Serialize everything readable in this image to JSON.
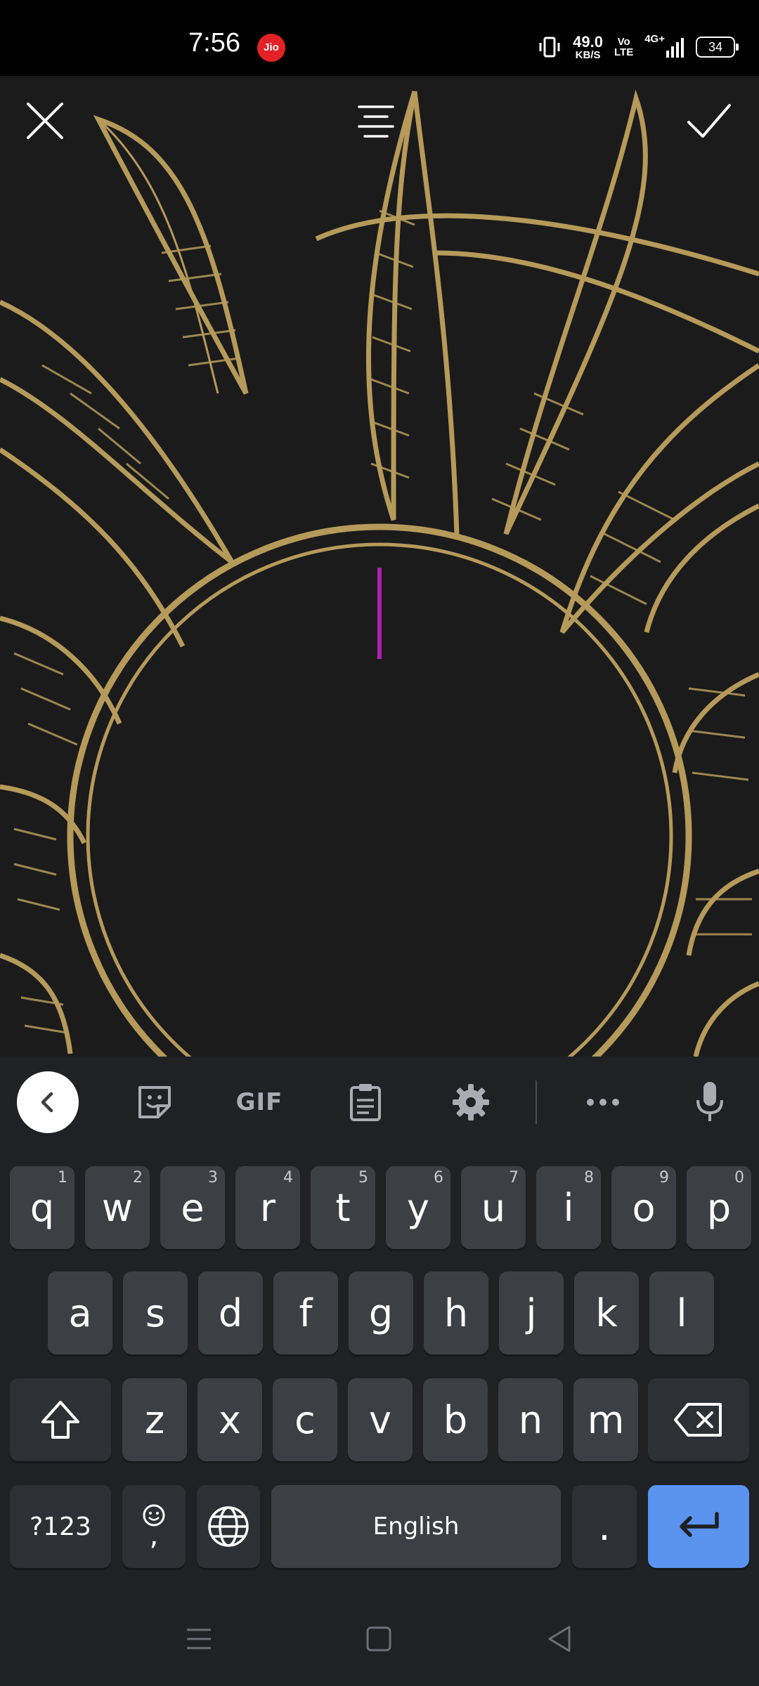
{
  "status_bar": {
    "time": "7:56",
    "carrier_badge": "Jio",
    "speed_value": "49.0",
    "speed_unit": "KB/S",
    "volte_top": "Vo",
    "volte_bottom": "LTE",
    "network": "4G+",
    "battery": "34"
  },
  "editor": {
    "close_icon": "close-icon",
    "align_icon": "text-align-center-icon",
    "confirm_icon": "check-icon",
    "cursor_color": "#b01fb5",
    "artwork": "black and gold sun illustration"
  },
  "keyboard": {
    "toolbar": {
      "back_icon": "chevron-left-icon",
      "sticker_icon": "sticker-icon",
      "gif_label": "GIF",
      "clipboard_icon": "clipboard-icon",
      "settings_icon": "gear-icon",
      "more_icon": "more-horizontal-icon",
      "mic_icon": "microphone-icon"
    },
    "row1": [
      {
        "key": "q",
        "hint": "1"
      },
      {
        "key": "w",
        "hint": "2"
      },
      {
        "key": "e",
        "hint": "3"
      },
      {
        "key": "r",
        "hint": "4"
      },
      {
        "key": "t",
        "hint": "5"
      },
      {
        "key": "y",
        "hint": "6"
      },
      {
        "key": "u",
        "hint": "7"
      },
      {
        "key": "i",
        "hint": "8"
      },
      {
        "key": "o",
        "hint": "9"
      },
      {
        "key": "p",
        "hint": "0"
      }
    ],
    "row2": [
      "a",
      "s",
      "d",
      "f",
      "g",
      "h",
      "j",
      "k",
      "l"
    ],
    "row3": [
      "z",
      "x",
      "c",
      "v",
      "b",
      "n",
      "m"
    ],
    "symbols_label": "?123",
    "comma_label": ",",
    "space_label": "English",
    "period_label": ".",
    "accent_color": "#5b93f0"
  },
  "nav_bar": {
    "menu_icon": "recent-apps-icon",
    "home_icon": "home-icon",
    "back_icon": "back-triangle-icon"
  }
}
